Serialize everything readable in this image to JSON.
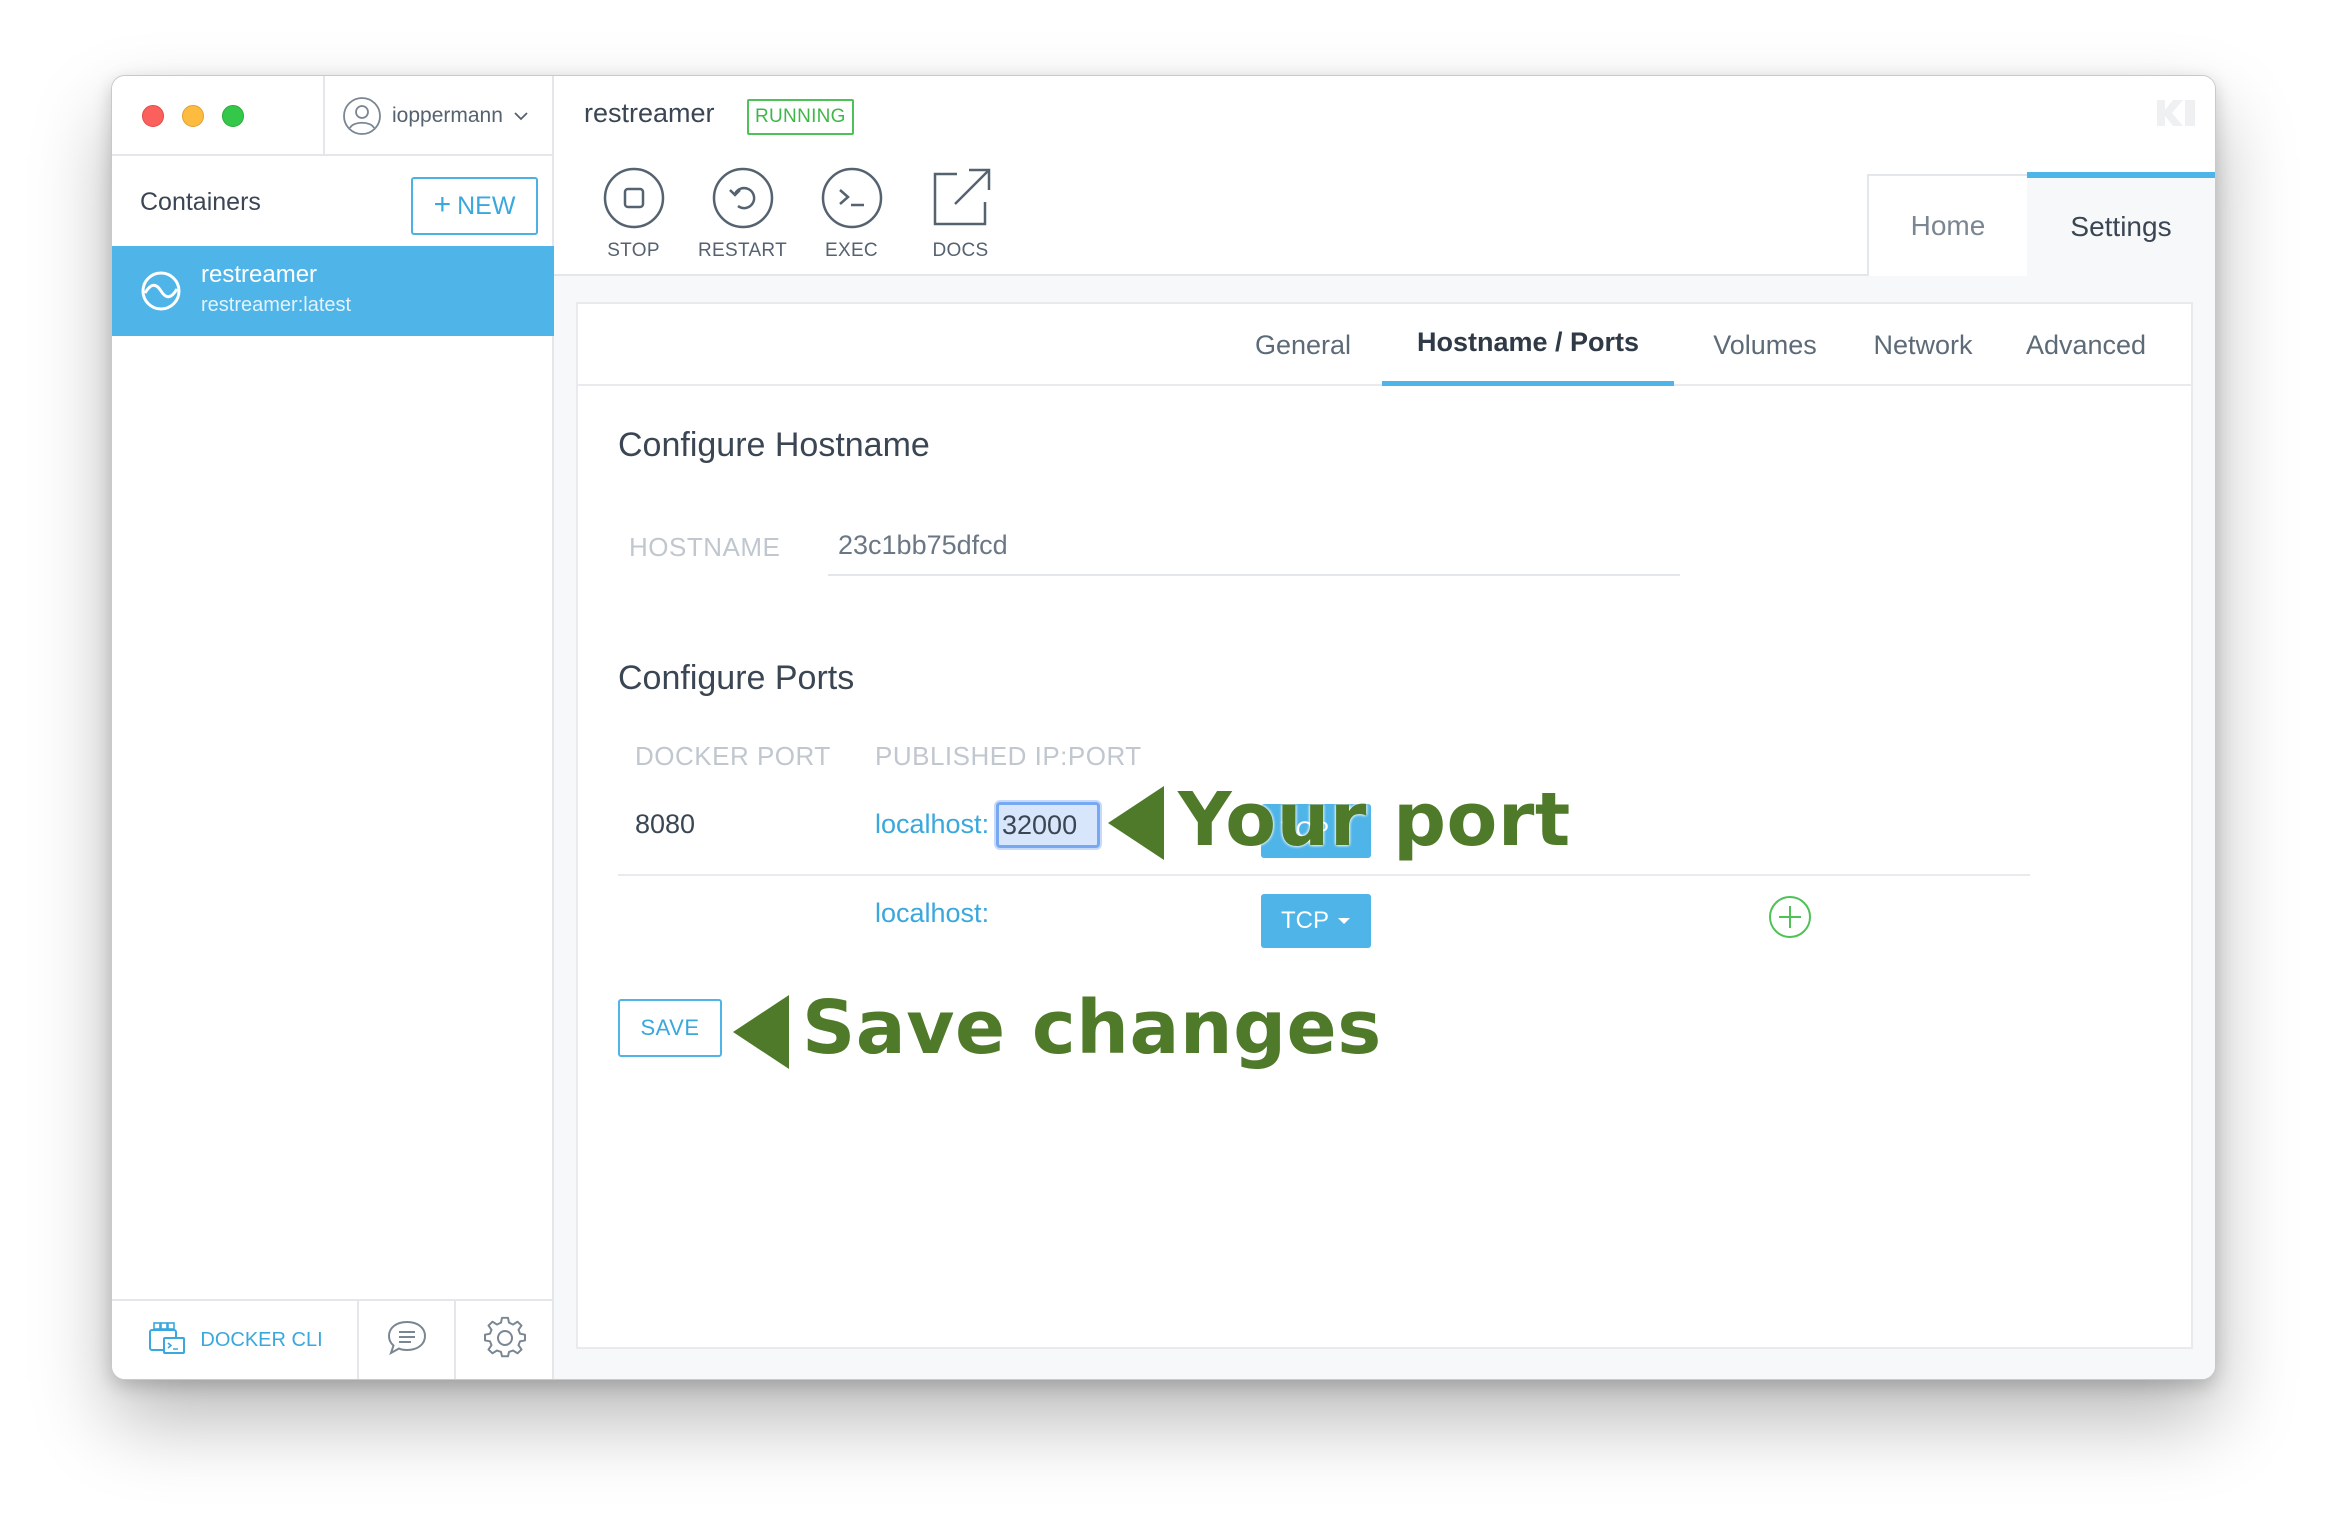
{
  "window": {
    "user": {
      "name": "ioppermann"
    }
  },
  "sidebar": {
    "title": "Containers",
    "new_label": "NEW",
    "containers": [
      {
        "name": "restreamer",
        "image": "restreamer:latest",
        "selected": true
      }
    ],
    "footer": {
      "cli_label": "DOCKER CLI"
    }
  },
  "header": {
    "container_name": "restreamer",
    "status": "RUNNING",
    "status_color": "#3fb748",
    "actions": [
      {
        "label": "STOP",
        "icon": "stop-icon"
      },
      {
        "label": "RESTART",
        "icon": "restart-icon"
      },
      {
        "label": "EXEC",
        "icon": "terminal-icon"
      },
      {
        "label": "DOCS",
        "icon": "external-link-icon"
      }
    ],
    "tabs": {
      "home": "Home",
      "settings": "Settings"
    },
    "active_tab": "Settings"
  },
  "settings": {
    "subtabs": [
      "General",
      "Hostname / Ports",
      "Volumes",
      "Network",
      "Advanced"
    ],
    "active_subtab": "Hostname / Ports",
    "hostname_section": {
      "title": "Configure Hostname",
      "label": "HOSTNAME",
      "value": "23c1bb75dfcd"
    },
    "ports_section": {
      "title": "Configure Ports",
      "col_docker_port": "DOCKER PORT",
      "col_published": "PUBLISHED IP:PORT",
      "rows": [
        {
          "docker_port": "8080",
          "host": "localhost:",
          "port": "32000",
          "protocol": "TCP"
        },
        {
          "docker_port": "",
          "host": "localhost:",
          "port": "",
          "protocol": "TCP"
        }
      ]
    },
    "save_label": "SAVE"
  },
  "annotations": {
    "port_note": "Your port",
    "save_note": "Save changes",
    "color": "#4f7a2a"
  },
  "colors": {
    "accent": "#4fb4e7",
    "running": "#3fb748"
  }
}
